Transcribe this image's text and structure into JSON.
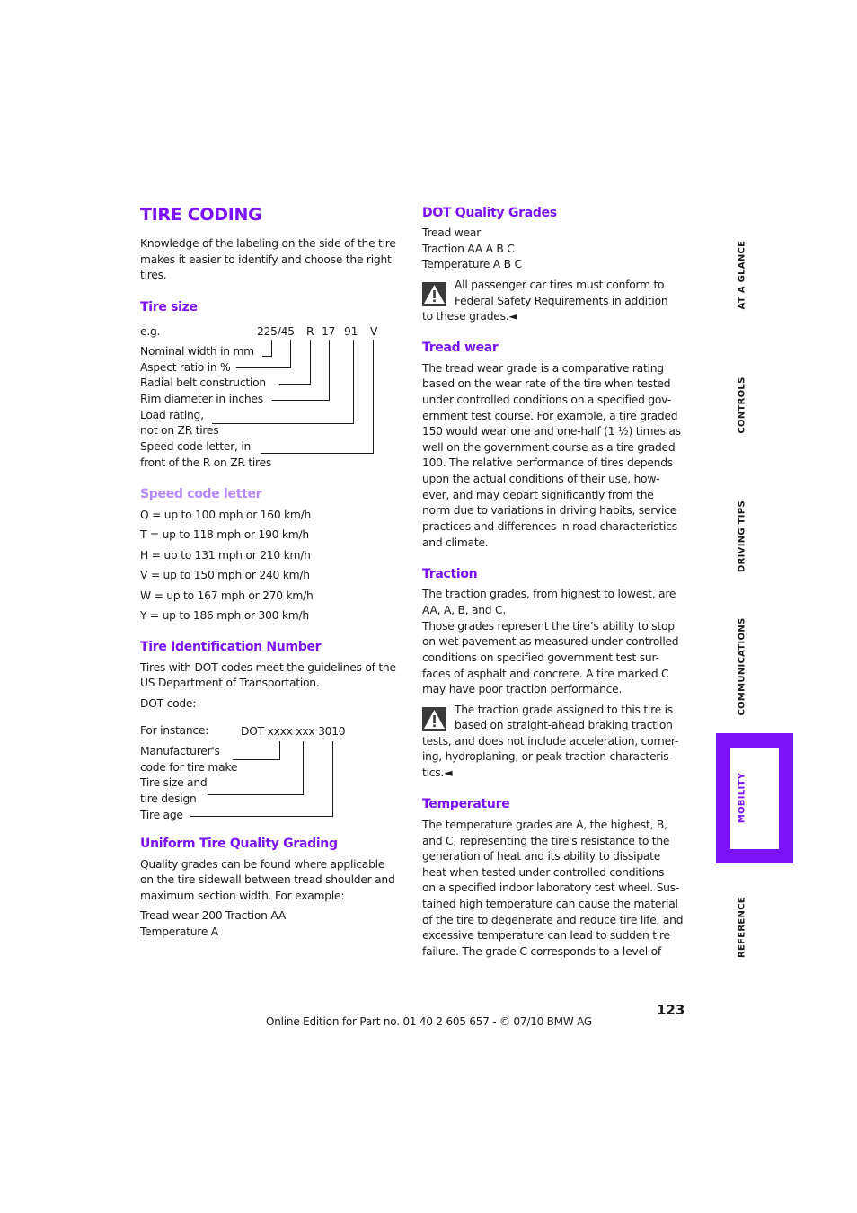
{
  "title": "TIRE CODING",
  "intro": [
    "Knowledge of the labeling on the side of the tire",
    "makes it easier to identify and choose the right",
    "tires."
  ],
  "tire_size": {
    "heading": "Tire size",
    "example_label": "e.g.",
    "code_parts": [
      "225/45",
      "R",
      "17",
      "91",
      "V"
    ],
    "labels": [
      "Nominal width in mm",
      "Aspect ratio in %",
      "Radial belt construction",
      "Rim diameter in inches",
      "Load rating,",
      "not on ZR tires",
      "Speed code letter, in",
      "front of the R on ZR tires"
    ]
  },
  "speed_code": {
    "heading": "Speed code letter",
    "items": [
      "Q = up to 100 mph or 160 km/h",
      "T = up to 118 mph or 190 km/h",
      "H = up to 131 mph or 210 km/h",
      "V = up to 150 mph or 240 km/h",
      "W = up to 167 mph or 270 km/h",
      "Y = up to 186 mph or 300 km/h"
    ]
  },
  "tin": {
    "heading": "Tire Identification Number",
    "text": [
      "Tires with DOT codes meet the guidelines of the",
      "US Department of Transportation."
    ],
    "dot_label": "DOT code:",
    "instance_label": "For instance:",
    "instance_code": "DOT xxxx xxx 3010",
    "labels": [
      "Manufacturer's",
      "code for tire make",
      "Tire size and",
      "tire design",
      "Tire age"
    ]
  },
  "utqg": {
    "heading": "Uniform Tire Quality Grading",
    "text": [
      "Quality grades can be found where applicable",
      "on the tire sidewall between tread shoulder and",
      "maximum section width. For example:"
    ],
    "example": [
      "Tread wear 200 Traction AA",
      "Temperature A"
    ]
  },
  "dot_grades": {
    "heading": "DOT Quality Grades",
    "lines": [
      "Tread wear",
      "Traction AA A B C",
      "Temperature A B C"
    ],
    "warning": [
      "All passenger car tires must conform to",
      "Federal Safety Requirements in addition",
      "to these grades.◄"
    ]
  },
  "tread_wear": {
    "heading": "Tread wear",
    "lines": [
      "The tread wear grade is a comparative rating",
      "based on the wear rate of the tire when tested",
      "under controlled conditions on a specified gov-",
      "ernment test course. For example, a tire graded",
      "150 would wear one and one-half (1 ½) times as",
      "well on the government course as a tire graded",
      "100. The relative performance of tires depends",
      "upon the actual conditions of their use, how-",
      "ever, and may depart significantly from the",
      "norm due to variations in driving habits, service",
      "practices and differences in road characteristics",
      "and climate."
    ]
  },
  "traction": {
    "heading": "Traction",
    "lines": [
      "The traction grades, from highest to lowest, are",
      "AA, A, B, and C.",
      "Those grades represent the tire’s ability to stop",
      "on wet pavement as measured under controlled",
      "conditions on specified government test sur-",
      "faces of asphalt and concrete. A tire marked C",
      "may have poor traction performance."
    ],
    "warning": [
      "The traction grade assigned to this tire is",
      "based on straight-ahead braking traction",
      "tests, and does not include acceleration, corner-",
      "ing, hydroplaning, or peak traction characteris-",
      "tics.◄"
    ]
  },
  "temperature": {
    "heading": "Temperature",
    "lines": [
      "The temperature grades are A, the highest, B,",
      "and C, representing the tire's resistance to the",
      "generation of heat and its ability to dissipate",
      "heat when tested under controlled conditions",
      "on a specified indoor laboratory test wheel. Sus-",
      "tained high temperature can cause the material",
      "of the tire to degenerate and reduce tire life, and",
      "excessive temperature can lead to sudden tire",
      "failure. The grade C corresponds to a level of"
    ]
  },
  "side_tabs": [
    "AT A GLANCE",
    "CONTROLS",
    "DRIVING TIPS",
    "COMMUNICATIONS",
    "MOBILITY",
    "REFERENCE"
  ],
  "active_tab": "MOBILITY",
  "colors": {
    "accent": "#7b12f5",
    "accent_light": "#b58af7",
    "text": "#1a1a1a"
  },
  "page_number": "123",
  "footer": "Online Edition for Part no. 01 40 2 605 657 - © 07/10  BMW AG"
}
